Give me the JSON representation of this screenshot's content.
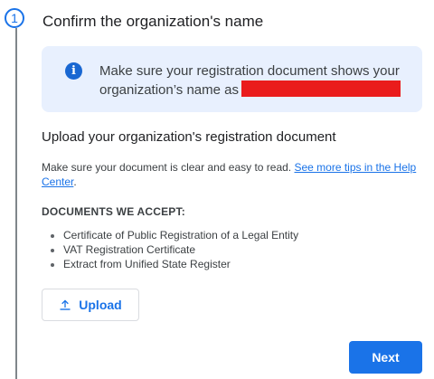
{
  "step": {
    "number": "1",
    "title": "Confirm the organization's name"
  },
  "info_banner": {
    "icon": "info-icon",
    "icon_glyph": "i",
    "text": "Make sure your registration document shows your organization’s name as"
  },
  "upload_section": {
    "heading": "Upload your organization's registration document",
    "help_text": "Make sure your document is clear and easy to read.",
    "help_link": "See more tips in the Help Center",
    "help_suffix": ".",
    "accept_heading": "DOCUMENTS WE ACCEPT:",
    "documents": [
      "Certificate of Public Registration of a Legal Entity",
      "VAT Registration Certificate",
      "Extract from Unified State Register"
    ],
    "upload_icon": "upload-icon",
    "upload_label": "Upload"
  },
  "actions": {
    "next_label": "Next"
  },
  "colors": {
    "accent": "#1a73e8",
    "banner_bg": "#e8f0fe",
    "redaction": "#ea1c1c"
  }
}
